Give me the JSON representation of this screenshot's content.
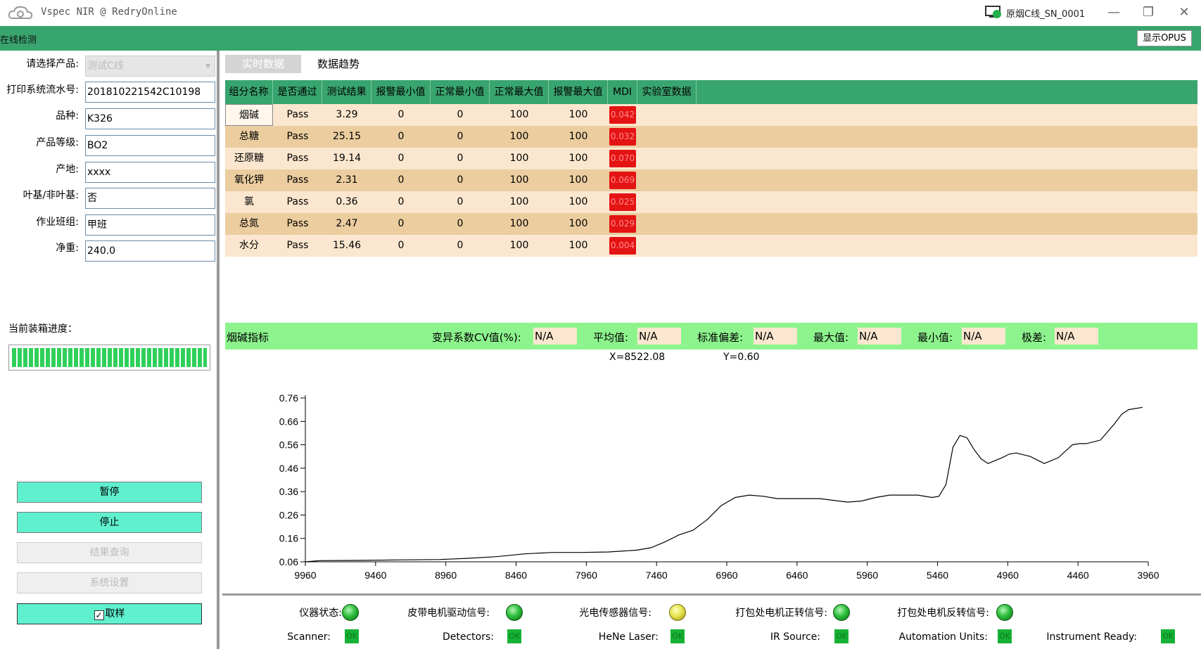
{
  "window": {
    "title": "Vspec NIR @ RedryOnline",
    "device_label": "原烟C线_SN_0001"
  },
  "header": {
    "title": "在线检测",
    "opus_button": "显示OPUS"
  },
  "form": {
    "product_label": "请选择产品:",
    "product_value": "测试C线",
    "serial_label": "打印系统流水号:",
    "serial_value": "201810221542C10198",
    "variety_label": "品种:",
    "variety_value": "K326",
    "grade_label": "产品等级:",
    "grade_value": "BO2",
    "origin_label": "产地:",
    "origin_value": "xxxx",
    "leaf_label": "叶基/非叶基:",
    "leaf_value": "否",
    "shift_label": "作业班组:",
    "shift_value": "甲班",
    "weight_label": "净重:",
    "weight_value": "240.0"
  },
  "progress": {
    "label": "当前装箱进度：",
    "fraction": 1.0
  },
  "buttons": {
    "pause": "暂停",
    "stop": "停止",
    "result_query": "结果查询",
    "system_settings": "系统设置",
    "sample": "取样"
  },
  "tabs": {
    "realtime": "实时数据",
    "trend": "数据趋势"
  },
  "table": {
    "headers": [
      "组分名称",
      "是否通过",
      "测试结果",
      "报警最小值",
      "正常最小值",
      "正常最大值",
      "报警最大值",
      "MDI",
      "实验室数据"
    ],
    "rows": [
      {
        "name": "烟碱",
        "pass": "Pass",
        "result": "3.29",
        "alarm_min": "0",
        "normal_min": "0",
        "normal_max": "100",
        "alarm_max": "100",
        "mdi": "0.042",
        "lab": ""
      },
      {
        "name": "总糖",
        "pass": "Pass",
        "result": "25.15",
        "alarm_min": "0",
        "normal_min": "0",
        "normal_max": "100",
        "alarm_max": "100",
        "mdi": "0.032",
        "lab": ""
      },
      {
        "name": "还原糖",
        "pass": "Pass",
        "result": "19.14",
        "alarm_min": "0",
        "normal_min": "0",
        "normal_max": "100",
        "alarm_max": "100",
        "mdi": "0.070",
        "lab": ""
      },
      {
        "name": "氧化钾",
        "pass": "Pass",
        "result": "2.31",
        "alarm_min": "0",
        "normal_min": "0",
        "normal_max": "100",
        "alarm_max": "100",
        "mdi": "0.069",
        "lab": ""
      },
      {
        "name": "氯",
        "pass": "Pass",
        "result": "0.36",
        "alarm_min": "0",
        "normal_min": "0",
        "normal_max": "100",
        "alarm_max": "100",
        "mdi": "0.025",
        "lab": ""
      },
      {
        "name": "总氮",
        "pass": "Pass",
        "result": "2.47",
        "alarm_min": "0",
        "normal_min": "0",
        "normal_max": "100",
        "alarm_max": "100",
        "mdi": "0.029",
        "lab": ""
      },
      {
        "name": "水分",
        "pass": "Pass",
        "result": "15.46",
        "alarm_min": "0",
        "normal_min": "0",
        "normal_max": "100",
        "alarm_max": "100",
        "mdi": "0.004",
        "lab": ""
      }
    ]
  },
  "stats": {
    "indicator": "烟碱指标",
    "cv_label": "变异系数CV值(%):",
    "cv_value": "N/A",
    "mean_label": "平均值:",
    "mean_value": "N/A",
    "std_label": "标准偏差:",
    "std_value": "N/A",
    "max_label": "最大值:",
    "max_value": "N/A",
    "min_label": "最小值:",
    "min_value": "N/A",
    "range_label": "极差:",
    "range_value": "N/A"
  },
  "cursor": {
    "x_text": "X=8522.08",
    "y_text": "Y=0.60"
  },
  "chart_data": {
    "type": "line",
    "xlabel": "",
    "ylabel": "",
    "xlim": [
      9960,
      3960
    ],
    "ylim": [
      0.06,
      0.76
    ],
    "x_ticks": [
      "9960",
      "9460",
      "8960",
      "8460",
      "7960",
      "7460",
      "6960",
      "6460",
      "5960",
      "5460",
      "4960",
      "4460",
      "3960"
    ],
    "y_ticks": [
      "0.76",
      "0.66",
      "0.56",
      "0.46",
      "0.36",
      "0.26",
      "0.16",
      "0.06"
    ],
    "series": [
      {
        "x": [
          9960,
          9860,
          9600,
          9300,
          9000,
          8800,
          8600,
          8400,
          8200,
          8000,
          7800,
          7600,
          7500,
          7400,
          7300,
          7200,
          7100,
          7000,
          6900,
          6800,
          6700,
          6600,
          6500,
          6300,
          6100,
          6000,
          5900,
          5800,
          5700,
          5600,
          5500,
          5450,
          5400,
          5350,
          5300,
          5250,
          5200,
          5150,
          5100,
          5000,
          4950,
          4900,
          4800,
          4700,
          4600,
          4500,
          4450,
          4400,
          4300,
          4200,
          4150,
          4100,
          4000
        ],
        "y": [
          0.06,
          0.065,
          0.066,
          0.068,
          0.07,
          0.075,
          0.082,
          0.094,
          0.1,
          0.1,
          0.102,
          0.11,
          0.12,
          0.145,
          0.175,
          0.195,
          0.24,
          0.3,
          0.335,
          0.345,
          0.34,
          0.33,
          0.33,
          0.33,
          0.315,
          0.32,
          0.335,
          0.345,
          0.345,
          0.345,
          0.335,
          0.34,
          0.39,
          0.55,
          0.6,
          0.59,
          0.54,
          0.5,
          0.48,
          0.505,
          0.52,
          0.525,
          0.51,
          0.48,
          0.505,
          0.56,
          0.565,
          0.565,
          0.58,
          0.65,
          0.69,
          0.71,
          0.72
        ]
      }
    ]
  },
  "status": {
    "instrument_label": "仪器状态:",
    "belt_label": "皮带电机驱动信号:",
    "photo_label": "光电传感器信号:",
    "pack_fwd_label": "打包处电机正转信号:",
    "pack_rev_label": "打包处电机反转信号:",
    "scanner_label": "Scanner:",
    "detectors_label": "Detectors:",
    "laser_label": "HeNe Laser:",
    "ir_label": "IR Source:",
    "automation_label": "Automation Units:",
    "ready_label": "Instrument Ready:",
    "ok_text": "OK",
    "led_green": "#2fbf3d",
    "led_yellow": "#e6e34c"
  },
  "colors": {
    "header_green": "#38a46e",
    "stats_green": "#8df48d",
    "button_cyan": "#5ff0ce",
    "mdi_red": "#e41414"
  }
}
